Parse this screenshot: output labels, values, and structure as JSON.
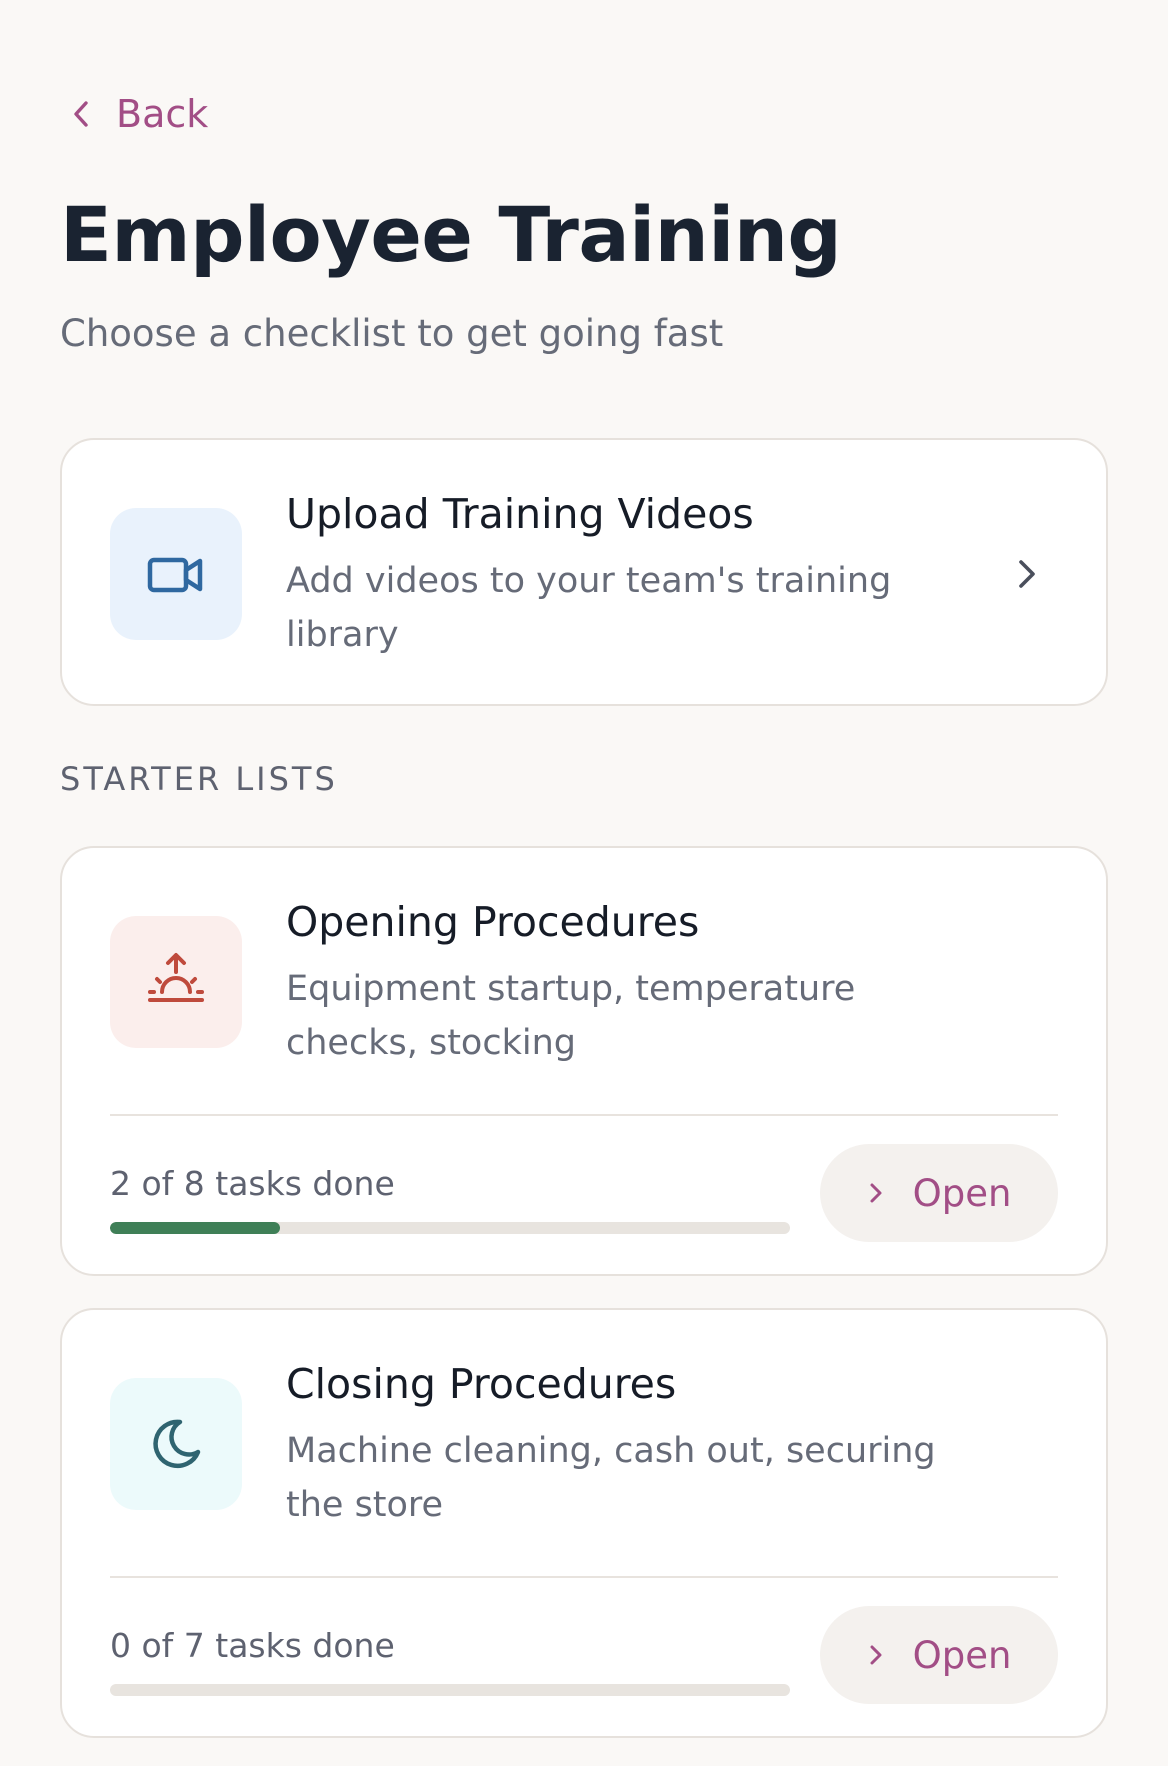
{
  "header": {
    "back_label": "Back",
    "title": "Employee Training",
    "subtitle": "Choose a checklist to get going fast"
  },
  "upload_card": {
    "title": "Upload Training Videos",
    "description": "Add videos to your team's training library",
    "icon": "video-camera-icon",
    "tile_color": "#e9f2fc",
    "icon_color": "#2f68a0"
  },
  "section_label": "STARTER LISTS",
  "checklists": [
    {
      "title": "Opening Procedures",
      "description": "Equipment startup, temperature checks, stocking",
      "icon": "sunrise-icon",
      "tile_color": "#fbeeec",
      "icon_color": "#bf4a3c",
      "progress_text": "2 of 8 tasks done",
      "done": 2,
      "total": 8,
      "open_label": "Open"
    },
    {
      "title": "Closing Procedures",
      "description": "Machine cleaning, cash out, securing the store",
      "icon": "moon-icon",
      "tile_color": "#ecfafb",
      "icon_color": "#2f6470",
      "progress_text": "0 of 7 tasks done",
      "done": 0,
      "total": 7,
      "open_label": "Open"
    }
  ],
  "colors": {
    "accent": "#a24e86",
    "progress": "#3f7f57",
    "background": "#faf8f6"
  }
}
